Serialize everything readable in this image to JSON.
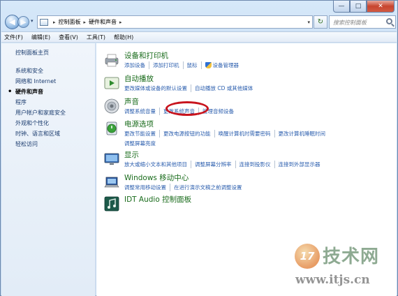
{
  "window": {
    "controls": {
      "minimize": "—",
      "maximize": "□",
      "close": "✕"
    }
  },
  "nav": {
    "back": "◀",
    "forward": "▶",
    "dropdown": "▾"
  },
  "address": {
    "crumbs": [
      "控制面板",
      "硬件和声音"
    ],
    "separator": "▸",
    "dropdown": "▾",
    "refresh": "↻"
  },
  "search": {
    "placeholder": "搜索控制面板"
  },
  "menu": [
    "文件(F)",
    "编辑(E)",
    "查看(V)",
    "工具(T)",
    "帮助(H)"
  ],
  "sidebar": {
    "home": "控制面板主页",
    "items": [
      "系统和安全",
      "网络和 Internet",
      "硬件和声音",
      "程序",
      "用户帐户和家庭安全",
      "外观和个性化",
      "时钟、语言和区域",
      "轻松访问"
    ],
    "active": "硬件和声音"
  },
  "categories": [
    {
      "title": "设备和打印机",
      "links": [
        "添加设备",
        "添加打印机",
        "鼠标",
        "设备管理器"
      ]
    },
    {
      "title": "自动播放",
      "links": [
        "更改媒体或设备的默认设置",
        "自动播放 CD 或其他媒体"
      ]
    },
    {
      "title": "声音",
      "links": [
        "调整系统音量",
        "更改系统声音",
        "管理音频设备"
      ]
    },
    {
      "title": "电源选项",
      "links": [
        "更改节能设置",
        "更改电源按钮的功能",
        "唤醒计算机时需要密码",
        "更改计算机睡眠时间"
      ],
      "links2": [
        "调整屏幕亮度"
      ]
    },
    {
      "title": "显示",
      "links": [
        "放大或缩小文本和其他项目",
        "调整屏幕分辨率",
        "连接到投影仪",
        "连接到外部显示器"
      ]
    },
    {
      "title": "Windows 移动中心",
      "links": [
        "调整常用移动设置",
        "在进行演示文稿之前调整设置"
      ]
    },
    {
      "title": "IDT Audio 控制面板",
      "links": []
    }
  ],
  "watermark": {
    "logo": "17",
    "brand": "技术网",
    "url": "www.itjs.cn"
  },
  "colors": {
    "link": "#2b5eae",
    "category_title": "#196b1b",
    "highlight": "#c8141d"
  }
}
